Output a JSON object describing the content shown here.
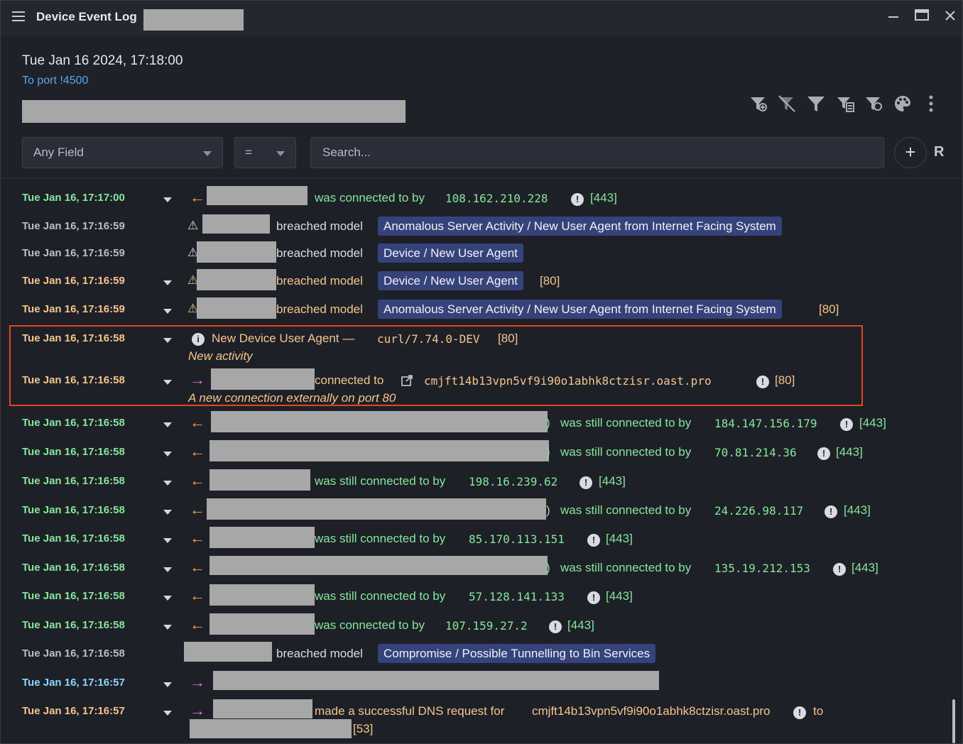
{
  "window": {
    "title": "Device Event Log"
  },
  "header": {
    "datetime": "Tue Jan 16 2024, 17:18:00",
    "port_link": "To port !4500"
  },
  "toolbar_icons": [
    "filter-add-icon",
    "filter-clear-icon",
    "filter-icon",
    "filter-list-icon",
    "filter-toggle-icon",
    "palette-icon",
    "more-vertical-icon"
  ],
  "filter": {
    "field_select": "Any Field",
    "operator_select": "=",
    "search_placeholder": "Search...",
    "add_label": "+",
    "r_label": "R"
  },
  "events": [
    {
      "time": "Tue Jan 16, 17:17:00",
      "text": "was connected to by",
      "ip": "108.162.210.228",
      "port": "[443]"
    },
    {
      "time": "Tue Jan 16, 17:16:59",
      "text": "breached model",
      "model": "Anomalous Server Activity / New User Agent from Internet Facing System"
    },
    {
      "time": "Tue Jan 16, 17:16:59",
      "text": "breached model",
      "model": "Device / New User Agent"
    },
    {
      "time": "Tue Jan 16, 17:16:59",
      "text": "breached model",
      "model": "Device / New User Agent",
      "port": "[80]"
    },
    {
      "time": "Tue Jan 16, 17:16:59",
      "text": "breached model",
      "model": "Anomalous Server Activity / New User Agent from Internet Facing System",
      "port": "[80]"
    },
    {
      "time": "Tue Jan 16, 17:16:58",
      "text": "New Device User Agent —",
      "agent": "curl/7.74.0-DEV",
      "port": "[80]",
      "sub": "New activity"
    },
    {
      "time": "Tue Jan 16, 17:16:58",
      "text": "connected to",
      "host": "cmjft14b13vpn5vf9i90o1abhk8ctzisr.oast.pro",
      "port": "[80]",
      "sub": "A new connection externally on port 80"
    },
    {
      "time": "Tue Jan 16, 17:16:58",
      "paren": ")",
      "text": "was still connected to by",
      "ip": "184.147.156.179",
      "port": "[443]"
    },
    {
      "time": "Tue Jan 16, 17:16:58",
      "paren": ")",
      "text": "was still connected to by",
      "ip": "70.81.214.36",
      "port": "[443]"
    },
    {
      "time": "Tue Jan 16, 17:16:58",
      "text": "was still connected to by",
      "ip": "198.16.239.62",
      "port": "[443]"
    },
    {
      "time": "Tue Jan 16, 17:16:58",
      "paren": ")",
      "text": "was still connected to by",
      "ip": "24.226.98.117",
      "port": "[443]"
    },
    {
      "time": "Tue Jan 16, 17:16:58",
      "text": "was still connected to by",
      "ip": "85.170.113.151",
      "port": "[443]"
    },
    {
      "time": "Tue Jan 16, 17:16:58",
      "paren": ")",
      "text": "was still connected to by",
      "ip": "135.19.212.153",
      "port": "[443]"
    },
    {
      "time": "Tue Jan 16, 17:16:58",
      "text": "was still connected to by",
      "ip": "57.128.141.133",
      "port": "[443]"
    },
    {
      "time": "Tue Jan 16, 17:16:58",
      "text": "was connected to by",
      "ip": "107.159.27.2",
      "port": "[443]"
    },
    {
      "time": "Tue Jan 16, 17:16:58",
      "text": "breached model",
      "model": "Compromise / Possible Tunnelling to Bin Services"
    },
    {
      "time": "Tue Jan 16, 17:16:57"
    },
    {
      "time": "Tue Jan 16, 17:16:57",
      "text": "made a successful DNS request for",
      "host": "cmjft14b13vpn5vf9i90o1abhk8ctzisr.oast.pro",
      "to": "to",
      "port": "[53]"
    }
  ],
  "colors": {
    "accent_green": "#86e79a",
    "accent_orange": "#f5c58a",
    "link_blue": "#5aa6e8",
    "model_tag": "#36427a",
    "highlight_border": "#e2461e"
  }
}
